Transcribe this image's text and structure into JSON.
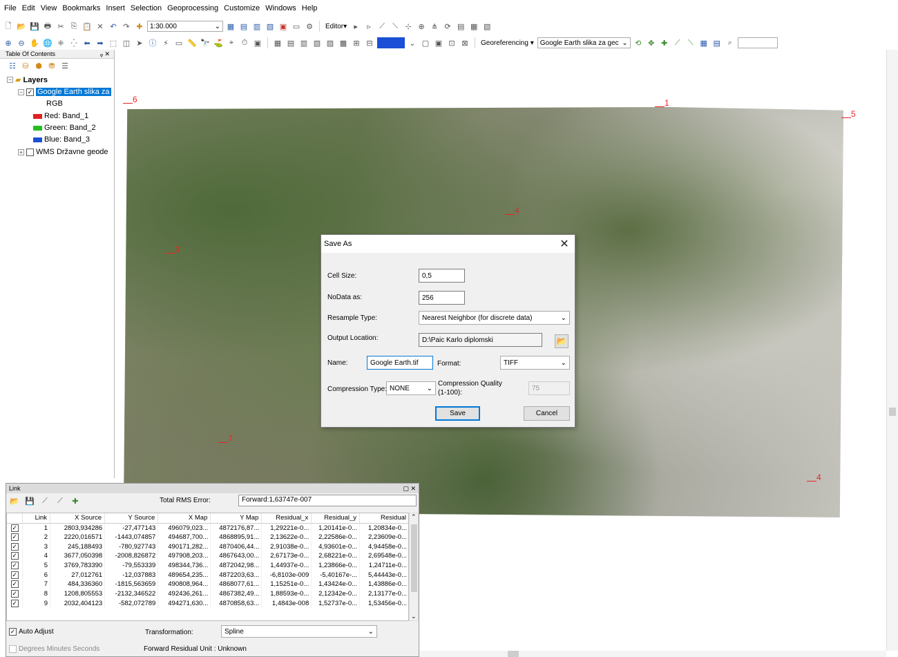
{
  "menu": [
    "File",
    "Edit",
    "View",
    "Bookmarks",
    "Insert",
    "Selection",
    "Geoprocessing",
    "Customize",
    "Windows",
    "Help"
  ],
  "toolbar": {
    "scale": "1:30.000",
    "editor_label": "Editor▾",
    "georef_label": "Georeferencing ▾",
    "georef_layer": "Google Earth slika za gec"
  },
  "toc": {
    "title": "Table Of Contents",
    "pin": "ᵩ ✕",
    "layers_label": "Layers",
    "layer1": "Google Earth slika za",
    "rgb": "RGB",
    "red": "Red:   Band_1",
    "green": "Green:  Band_2",
    "blue": "Blue:   Band_3",
    "layer2": "WMS Državne geode",
    "colors": {
      "red": "#e02020",
      "green": "#20c020",
      "blue": "#1a4fd6"
    }
  },
  "map": {
    "gcps": [
      "6",
      "1",
      "5",
      "4",
      "3",
      "7",
      "4"
    ]
  },
  "dialog": {
    "title": "Save As",
    "cell_size_label": "Cell Size:",
    "cell_size": "0,5",
    "nodata_label": "NoData as:",
    "nodata": "256",
    "resample_label": "Resample Type:",
    "resample": "Nearest Neighbor (for discrete data)",
    "output_label": "Output Location:",
    "output": "D:\\Paic Karlo diplomski",
    "name_label": "Name:",
    "name": "Google Earth.tif",
    "format_label": "Format:",
    "format": "TIFF",
    "compression_label": "Compression Type:",
    "compression": "NONE",
    "quality_label_1": "Compression Quality",
    "quality_label_2": "(1-100):",
    "quality": "75",
    "save": "Save",
    "cancel": "Cancel"
  },
  "link": {
    "title": "Link",
    "rms_label": "Total RMS Error:",
    "rms_value": "Forward:1,63747e-007",
    "columns": [
      "",
      "Link",
      "X Source",
      "Y Source",
      "X Map",
      "Y Map",
      "Residual_x",
      "Residual_y",
      "Residual"
    ],
    "rows": [
      [
        "1",
        "2803,934286",
        "-27,477143",
        "496079,023...",
        "4872176,87...",
        "1,29221e-0...",
        "1,20141e-0...",
        "1,20834e-0..."
      ],
      [
        "2",
        "2220,016571",
        "-1443,074857",
        "494687,700...",
        "4868895,91...",
        "2,13622e-0...",
        "2,22586e-0...",
        "2,23609e-0..."
      ],
      [
        "3",
        "245,188493",
        "-780,927743",
        "490171,282...",
        "4870406,44...",
        "2,91038e-0...",
        "4,93601e-0...",
        "4,94458e-0..."
      ],
      [
        "4",
        "3677,050398",
        "-2008,826872",
        "497908,203...",
        "4867643,00...",
        "2,67173e-0...",
        "2,68221e-0...",
        "2,69548e-0..."
      ],
      [
        "5",
        "3769,783390",
        "-79,553339",
        "498344,736...",
        "4872042,98...",
        "1,44937e-0...",
        "1,23866e-0...",
        "1,24711e-0..."
      ],
      [
        "6",
        "27,012761",
        "-12,037883",
        "489654,235...",
        "4872203,63...",
        "-6,8103e-009",
        "-5,40167e-...",
        "5,44443e-0..."
      ],
      [
        "7",
        "484,336360",
        "-1815,563659",
        "490808,964...",
        "4868077,61...",
        "1,15251e-0...",
        "1,43424e-0...",
        "1,43886e-0..."
      ],
      [
        "8",
        "1208,805553",
        "-2132,346522",
        "492436,261...",
        "4867382,49...",
        "1,88593e-0...",
        "2,12342e-0...",
        "2,13177e-0..."
      ],
      [
        "9",
        "2032,404123",
        "-582,072789",
        "494271,630...",
        "4870858,63...",
        "1,4843e-008",
        "1,52737e-0...",
        "1,53456e-0..."
      ]
    ],
    "auto_adjust": "Auto Adjust",
    "transformation_label": "Transformation:",
    "transformation": "Spline",
    "dms": "Degrees Minutes Seconds",
    "residual_unit": "Forward Residual Unit : Unknown"
  }
}
